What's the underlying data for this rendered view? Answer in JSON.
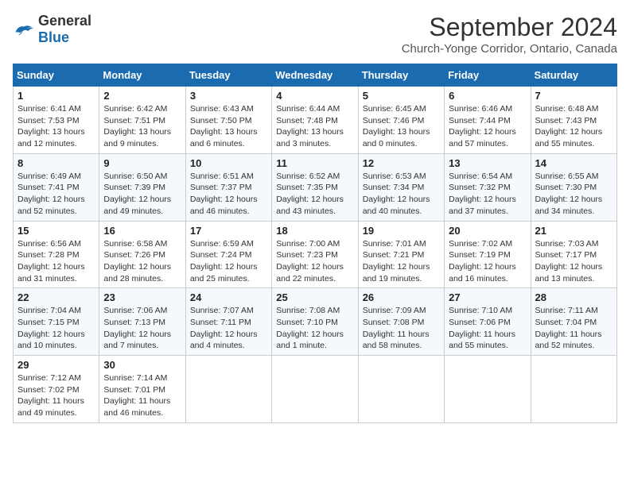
{
  "header": {
    "logo_general": "General",
    "logo_blue": "Blue",
    "main_title": "September 2024",
    "subtitle": "Church-Yonge Corridor, Ontario, Canada"
  },
  "weekdays": [
    "Sunday",
    "Monday",
    "Tuesday",
    "Wednesday",
    "Thursday",
    "Friday",
    "Saturday"
  ],
  "weeks": [
    [
      {
        "day": "1",
        "sunrise": "6:41 AM",
        "sunset": "7:53 PM",
        "daylight": "13 hours and 12 minutes."
      },
      {
        "day": "2",
        "sunrise": "6:42 AM",
        "sunset": "7:51 PM",
        "daylight": "13 hours and 9 minutes."
      },
      {
        "day": "3",
        "sunrise": "6:43 AM",
        "sunset": "7:50 PM",
        "daylight": "13 hours and 6 minutes."
      },
      {
        "day": "4",
        "sunrise": "6:44 AM",
        "sunset": "7:48 PM",
        "daylight": "13 hours and 3 minutes."
      },
      {
        "day": "5",
        "sunrise": "6:45 AM",
        "sunset": "7:46 PM",
        "daylight": "13 hours and 0 minutes."
      },
      {
        "day": "6",
        "sunrise": "6:46 AM",
        "sunset": "7:44 PM",
        "daylight": "12 hours and 57 minutes."
      },
      {
        "day": "7",
        "sunrise": "6:48 AM",
        "sunset": "7:43 PM",
        "daylight": "12 hours and 55 minutes."
      }
    ],
    [
      {
        "day": "8",
        "sunrise": "6:49 AM",
        "sunset": "7:41 PM",
        "daylight": "12 hours and 52 minutes."
      },
      {
        "day": "9",
        "sunrise": "6:50 AM",
        "sunset": "7:39 PM",
        "daylight": "12 hours and 49 minutes."
      },
      {
        "day": "10",
        "sunrise": "6:51 AM",
        "sunset": "7:37 PM",
        "daylight": "12 hours and 46 minutes."
      },
      {
        "day": "11",
        "sunrise": "6:52 AM",
        "sunset": "7:35 PM",
        "daylight": "12 hours and 43 minutes."
      },
      {
        "day": "12",
        "sunrise": "6:53 AM",
        "sunset": "7:34 PM",
        "daylight": "12 hours and 40 minutes."
      },
      {
        "day": "13",
        "sunrise": "6:54 AM",
        "sunset": "7:32 PM",
        "daylight": "12 hours and 37 minutes."
      },
      {
        "day": "14",
        "sunrise": "6:55 AM",
        "sunset": "7:30 PM",
        "daylight": "12 hours and 34 minutes."
      }
    ],
    [
      {
        "day": "15",
        "sunrise": "6:56 AM",
        "sunset": "7:28 PM",
        "daylight": "12 hours and 31 minutes."
      },
      {
        "day": "16",
        "sunrise": "6:58 AM",
        "sunset": "7:26 PM",
        "daylight": "12 hours and 28 minutes."
      },
      {
        "day": "17",
        "sunrise": "6:59 AM",
        "sunset": "7:24 PM",
        "daylight": "12 hours and 25 minutes."
      },
      {
        "day": "18",
        "sunrise": "7:00 AM",
        "sunset": "7:23 PM",
        "daylight": "12 hours and 22 minutes."
      },
      {
        "day": "19",
        "sunrise": "7:01 AM",
        "sunset": "7:21 PM",
        "daylight": "12 hours and 19 minutes."
      },
      {
        "day": "20",
        "sunrise": "7:02 AM",
        "sunset": "7:19 PM",
        "daylight": "12 hours and 16 minutes."
      },
      {
        "day": "21",
        "sunrise": "7:03 AM",
        "sunset": "7:17 PM",
        "daylight": "12 hours and 13 minutes."
      }
    ],
    [
      {
        "day": "22",
        "sunrise": "7:04 AM",
        "sunset": "7:15 PM",
        "daylight": "12 hours and 10 minutes."
      },
      {
        "day": "23",
        "sunrise": "7:06 AM",
        "sunset": "7:13 PM",
        "daylight": "12 hours and 7 minutes."
      },
      {
        "day": "24",
        "sunrise": "7:07 AM",
        "sunset": "7:11 PM",
        "daylight": "12 hours and 4 minutes."
      },
      {
        "day": "25",
        "sunrise": "7:08 AM",
        "sunset": "7:10 PM",
        "daylight": "12 hours and 1 minute."
      },
      {
        "day": "26",
        "sunrise": "7:09 AM",
        "sunset": "7:08 PM",
        "daylight": "11 hours and 58 minutes."
      },
      {
        "day": "27",
        "sunrise": "7:10 AM",
        "sunset": "7:06 PM",
        "daylight": "11 hours and 55 minutes."
      },
      {
        "day": "28",
        "sunrise": "7:11 AM",
        "sunset": "7:04 PM",
        "daylight": "11 hours and 52 minutes."
      }
    ],
    [
      {
        "day": "29",
        "sunrise": "7:12 AM",
        "sunset": "7:02 PM",
        "daylight": "11 hours and 49 minutes."
      },
      {
        "day": "30",
        "sunrise": "7:14 AM",
        "sunset": "7:01 PM",
        "daylight": "11 hours and 46 minutes."
      },
      null,
      null,
      null,
      null,
      null
    ]
  ],
  "labels": {
    "sunrise": "Sunrise:",
    "sunset": "Sunset:",
    "daylight": "Daylight:"
  }
}
